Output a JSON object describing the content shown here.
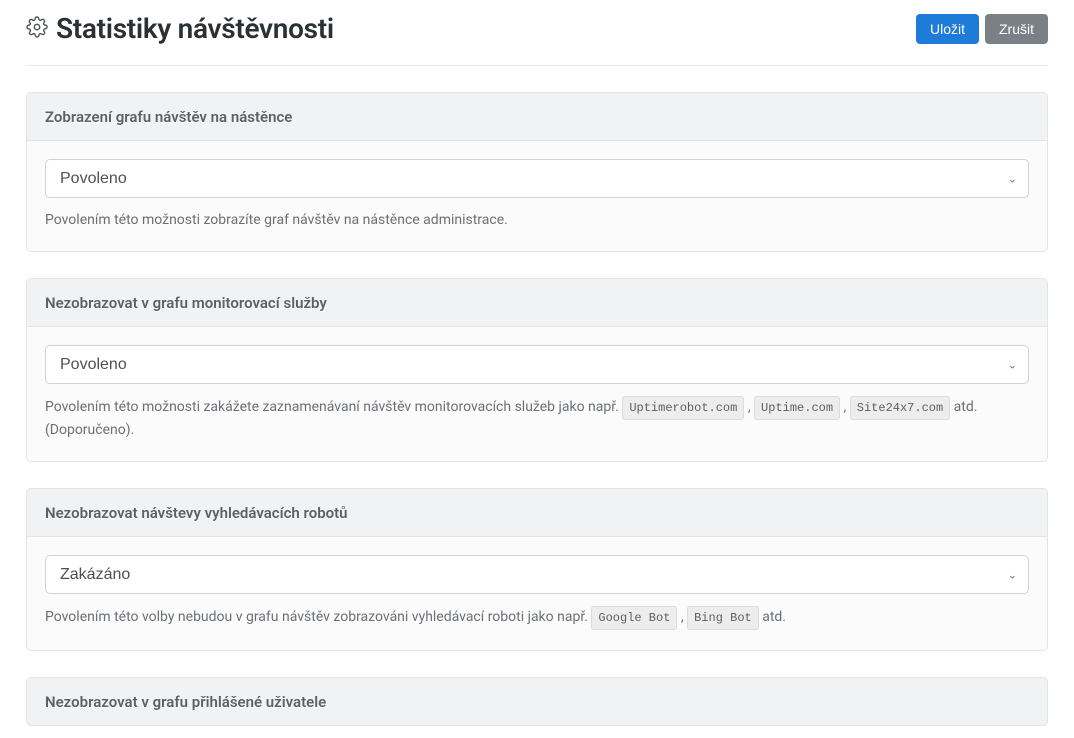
{
  "header": {
    "title": "Statistiky návštěvnosti",
    "save_label": "Uložit",
    "cancel_label": "Zrušit"
  },
  "select_options": {
    "enabled": "Povoleno",
    "disabled": "Zakázáno"
  },
  "panels": [
    {
      "title": "Zobrazení grafu návštěv na nástěnce",
      "value": "Povoleno",
      "help_prefix": "Povolením této možnosti zobrazíte graf návštěv na nástěnce administrace.",
      "tags": [],
      "help_suffix": ""
    },
    {
      "title": "Nezobrazovat v grafu monitorovací služby",
      "value": "Povoleno",
      "help_prefix": "Povolením této možnosti zakážete zaznamenávaní návštěv monitorovacích služeb jako např. ",
      "tags": [
        "Uptimerobot.com",
        "Uptime.com",
        "Site24x7.com"
      ],
      "help_suffix": " atd. (Doporučeno)."
    },
    {
      "title": "Nezobrazovat návštevy vyhledávacích robotů",
      "value": "Zakázáno",
      "help_prefix": "Povolením této volby nebudou v grafu návštěv zobrazováni vyhledávací roboti jako např. ",
      "tags": [
        "Google Bot",
        "Bing Bot"
      ],
      "help_suffix": " atd."
    },
    {
      "title": "Nezobrazovat v grafu přihlášené uživatele",
      "value": "",
      "help_prefix": "",
      "tags": [],
      "help_suffix": ""
    }
  ]
}
